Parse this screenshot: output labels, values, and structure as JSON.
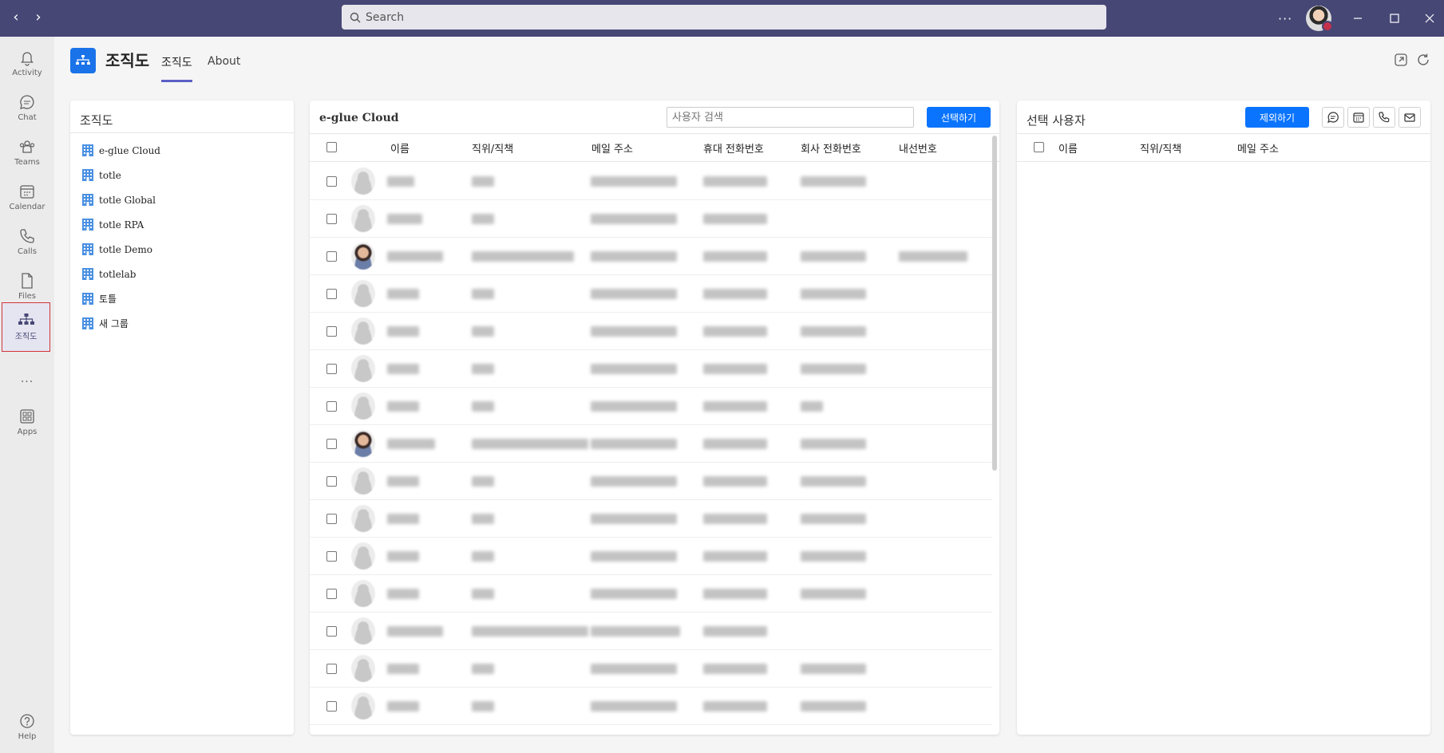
{
  "titlebar": {
    "search_placeholder": "Search",
    "more_label": "···"
  },
  "rail": [
    {
      "label": "Activity",
      "icon": "bell-icon"
    },
    {
      "label": "Chat",
      "icon": "chat-icon"
    },
    {
      "label": "Teams",
      "icon": "teams-icon"
    },
    {
      "label": "Calendar",
      "icon": "calendar-icon"
    },
    {
      "label": "Calls",
      "icon": "phone-icon"
    },
    {
      "label": "Files",
      "icon": "file-icon"
    },
    {
      "label": "조직도",
      "icon": "org-chart-icon"
    },
    {
      "label": "···",
      "icon": "more-icon"
    },
    {
      "label": "Apps",
      "icon": "apps-icon"
    },
    {
      "label": "Help",
      "icon": "help-icon"
    }
  ],
  "app": {
    "title": "조직도",
    "tabs": [
      "조직도",
      "About"
    ]
  },
  "org_panel": {
    "title": "조직도",
    "items": [
      "e-glue Cloud",
      "totle",
      "totle Global",
      "totle RPA",
      "totle Demo",
      "totlelab",
      "토틀",
      "새 그룹"
    ]
  },
  "user_panel": {
    "title": "e-glue Cloud",
    "search_placeholder": "사용자 검색",
    "select_button": "선택하기",
    "columns": [
      "이름",
      "직위/직책",
      "메일 주소",
      "휴대 전화번호",
      "회사 전화번호",
      "내선번호"
    ],
    "row_count": 15
  },
  "selected_panel": {
    "title": "선택 사용자",
    "remove_button": "제외하기",
    "columns": [
      "이름",
      "직위/직책",
      "메일 주소"
    ]
  },
  "colors": {
    "titlebar": "#464775",
    "accent": "#5b5fc7",
    "button": "#0a74ff"
  }
}
